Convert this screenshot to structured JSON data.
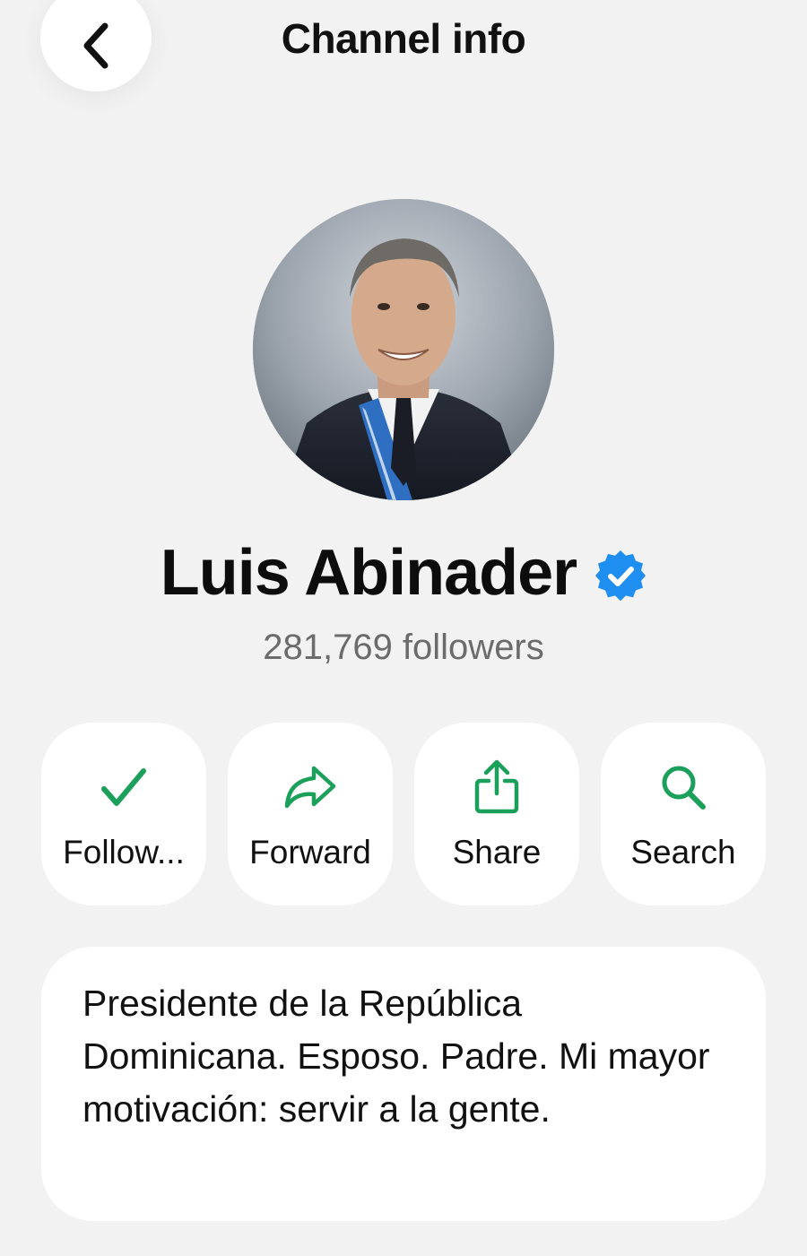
{
  "header": {
    "title": "Channel info",
    "back_icon": "chevron-left-icon"
  },
  "channel": {
    "name": "Luis Abinader",
    "verified": true,
    "verified_color": "#1f8ef1",
    "followers_text": "281,769 followers"
  },
  "actions": [
    {
      "label": "Follow...",
      "icon": "checkmark-icon"
    },
    {
      "label": "Forward",
      "icon": "forward-arrow-icon"
    },
    {
      "label": "Share",
      "icon": "share-icon"
    },
    {
      "label": "Search",
      "icon": "search-icon"
    }
  ],
  "description": {
    "text": "Presidente de la República Dominicana. Esposo. Padre. Mi mayor motivación: servir a la gente."
  },
  "colors": {
    "accent": "#1aa05a",
    "background": "#f2f2f2",
    "card": "#ffffff",
    "secondary_text": "#6b6b6b"
  }
}
